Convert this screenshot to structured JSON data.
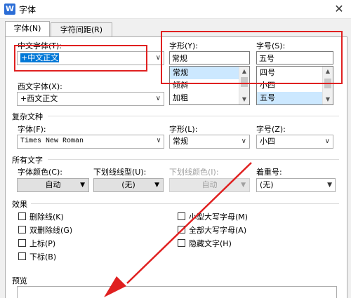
{
  "window": {
    "title": "字体",
    "title_icon": "W"
  },
  "tabs": [
    {
      "label": "字体(N)",
      "active": true
    },
    {
      "label": "字符间距(R)",
      "active": false
    }
  ],
  "chinese_font": {
    "label": "中文字体(T):",
    "value": "+中文正文"
  },
  "style": {
    "label": "字形(Y):",
    "value": "常规",
    "options": [
      "常规",
      "倾斜",
      "加粗"
    ],
    "selected": "常规"
  },
  "size": {
    "label": "字号(S):",
    "value": "五号",
    "options": [
      "四号",
      "小四",
      "五号"
    ],
    "selected": "五号"
  },
  "western_font": {
    "label": "西文字体(X):",
    "value": "+西文正文"
  },
  "complex": {
    "title": "复杂文种",
    "font_label": "字体(F):",
    "font_value": "Times New Roman",
    "style_label": "字形(L):",
    "style_value": "常规",
    "size_label": "字号(Z):",
    "size_value": "小四"
  },
  "all_text": {
    "title": "所有文字",
    "color_label": "字体颜色(C):",
    "color_value": "自动",
    "underline_label": "下划线线型(U):",
    "underline_value": "(无)",
    "underline_color_label": "下划线颜色(I):",
    "underline_color_value": "自动",
    "emphasis_label": "着重号:",
    "emphasis_value": "(无)"
  },
  "effects": {
    "title": "效果",
    "left": [
      "删除线(K)",
      "双删除线(G)",
      "上标(P)",
      "下标(B)"
    ],
    "right": [
      "小型大写字母(M)",
      "全部大写字母(A)",
      "隐藏文字(H)"
    ]
  },
  "preview": {
    "title": "预览"
  },
  "colors": {
    "highlight": "#cce8ff",
    "selected_text_bg": "#0078d7",
    "annotation_red": "#e02020",
    "title_icon": "#2b6dd6"
  }
}
